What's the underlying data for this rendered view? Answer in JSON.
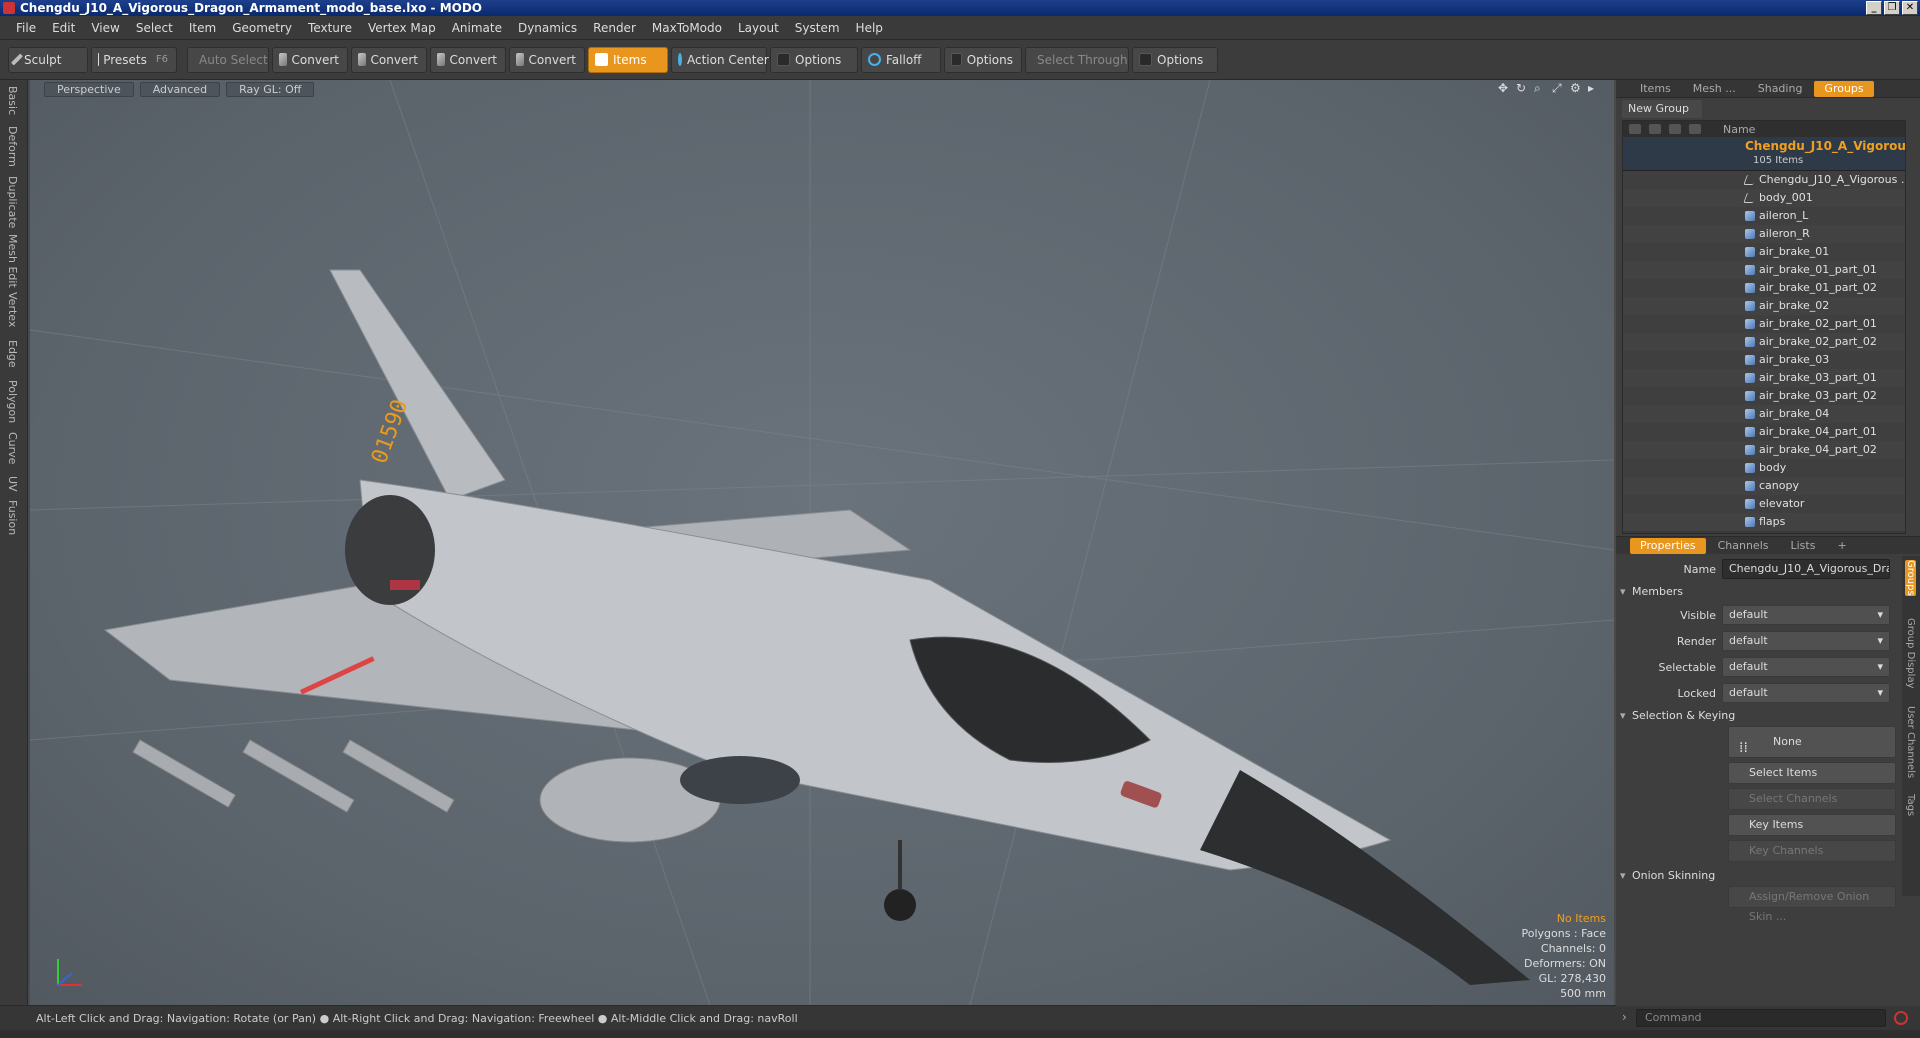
{
  "window": {
    "title": "Chengdu_J10_A_Vigorous_Dragon_Armament_modo_base.lxo - MODO"
  },
  "menu": [
    "File",
    "Edit",
    "View",
    "Select",
    "Item",
    "Geometry",
    "Texture",
    "Vertex Map",
    "Animate",
    "Dynamics",
    "Render",
    "MaxToModo",
    "Layout",
    "System",
    "Help"
  ],
  "toolbar": {
    "sculpt": "Sculpt",
    "presets": "Presets",
    "presets_key": "F6",
    "auto_select": "Auto Select",
    "convert1": "Convert",
    "convert2": "Convert",
    "convert3": "Convert",
    "convert4": "Convert",
    "items": "Items",
    "action_center": "Action Center",
    "options1": "Options",
    "falloff": "Falloff",
    "options2": "Options",
    "select_through": "Select Through",
    "options3": "Options"
  },
  "left_tabs": [
    "Basic",
    "Deform",
    "Duplicate",
    "Mesh Edit",
    "Vertex",
    "Edge",
    "Polygon",
    "Curve",
    "UV",
    "Fusion"
  ],
  "viewport": {
    "view": "Perspective",
    "mode": "Advanced",
    "raygl": "Ray GL: Off",
    "info_selection": "No Items",
    "info_polygons": "Polygons : Face",
    "info_channels": "Channels: 0",
    "info_deformers": "Deformers: ON",
    "info_gl": "GL: 278,430",
    "info_scale": "500 mm"
  },
  "status": {
    "hint1": "Alt-Left Click and Drag: Navigation: Rotate (or Pan)",
    "hint2": "Alt-Right Click and Drag: Navigation: Freewheel",
    "hint3": "Alt-Middle Click and Drag: navRoll"
  },
  "panel_tabs": {
    "items": "Items",
    "mesh": "Mesh ...",
    "shading": "Shading",
    "groups": "Groups"
  },
  "groups": {
    "new_group": "New Group",
    "col_name": "Name",
    "group_name": "Chengdu_J10_A_Vigorou...",
    "group_count": "105 Items",
    "items": [
      "Chengdu_J10_A_Vigorous ...",
      "body_001",
      "aileron_L",
      "aileron_R",
      "air_brake_01",
      "air_brake_01_part_01",
      "air_brake_01_part_02",
      "air_brake_02",
      "air_brake_02_part_01",
      "air_brake_02_part_02",
      "air_brake_03",
      "air_brake_03_part_01",
      "air_brake_03_part_02",
      "air_brake_04",
      "air_brake_04_part_01",
      "air_brake_04_part_02",
      "body",
      "canopy",
      "elevator",
      "flaps"
    ]
  },
  "prop_tabs": {
    "properties": "Properties",
    "channels": "Channels",
    "lists": "Lists",
    "plus": "+"
  },
  "properties": {
    "name_label": "Name",
    "name_value": "Chengdu_J10_A_Vigorous_Drag",
    "members": "Members",
    "visible_label": "Visible",
    "visible_value": "default",
    "render_label": "Render",
    "render_value": "default",
    "selectable_label": "Selectable",
    "selectable_value": "default",
    "locked_label": "Locked",
    "locked_value": "default",
    "selection_keying": "Selection & Keying",
    "none": "None",
    "select_items": "Select Items",
    "select_channels": "Select Channels",
    "key_items": "Key Items",
    "key_channels": "Key Channels",
    "onion": "Onion Skinning",
    "assign_onion": "Assign/Remove Onion Skin ..."
  },
  "side_tabs": [
    "Groups",
    "Group Display",
    "User Channels",
    "Tags"
  ],
  "command": {
    "placeholder": "Command"
  }
}
